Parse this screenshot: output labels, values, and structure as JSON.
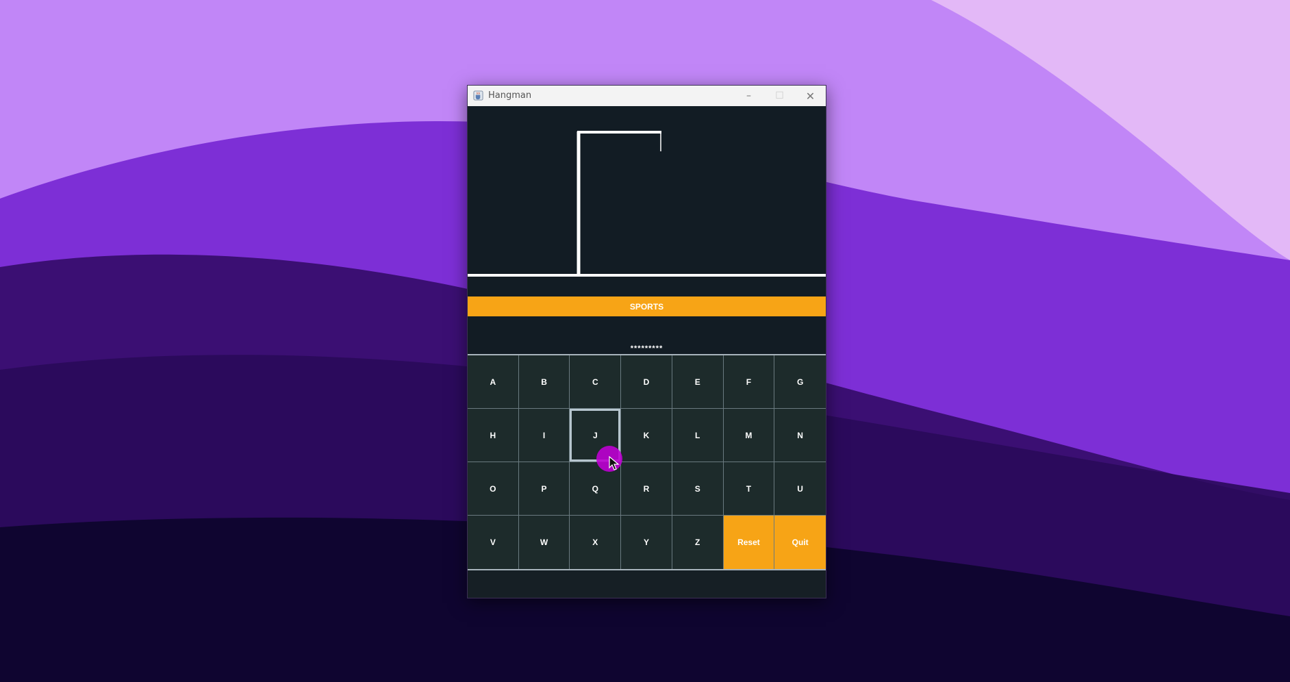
{
  "window": {
    "title": "Hangman",
    "controls": {
      "minimize": "–",
      "maximize": "☐",
      "close": "✕"
    }
  },
  "game": {
    "category": "SPORTS",
    "masked_word": "*********",
    "keys": [
      {
        "label": "A"
      },
      {
        "label": "B"
      },
      {
        "label": "C"
      },
      {
        "label": "D"
      },
      {
        "label": "E"
      },
      {
        "label": "F"
      },
      {
        "label": "G"
      },
      {
        "label": "H"
      },
      {
        "label": "I"
      },
      {
        "label": "J"
      },
      {
        "label": "K"
      },
      {
        "label": "L"
      },
      {
        "label": "M"
      },
      {
        "label": "N"
      },
      {
        "label": "O"
      },
      {
        "label": "P"
      },
      {
        "label": "Q"
      },
      {
        "label": "R"
      },
      {
        "label": "S"
      },
      {
        "label": "T"
      },
      {
        "label": "U"
      },
      {
        "label": "V"
      },
      {
        "label": "W"
      },
      {
        "label": "X"
      },
      {
        "label": "Y"
      },
      {
        "label": "Z"
      },
      {
        "label": "Reset"
      },
      {
        "label": "Quit"
      }
    ],
    "focused_key": "J"
  },
  "colors": {
    "accent": "#f7a416",
    "panel": "#121c24",
    "key_bg": "#1d2b2b",
    "text": "#ffffff",
    "cursor_highlight": "#be00d2"
  },
  "icons": {
    "app": "java-cup-icon",
    "cursor": "arrow-cursor-icon"
  }
}
